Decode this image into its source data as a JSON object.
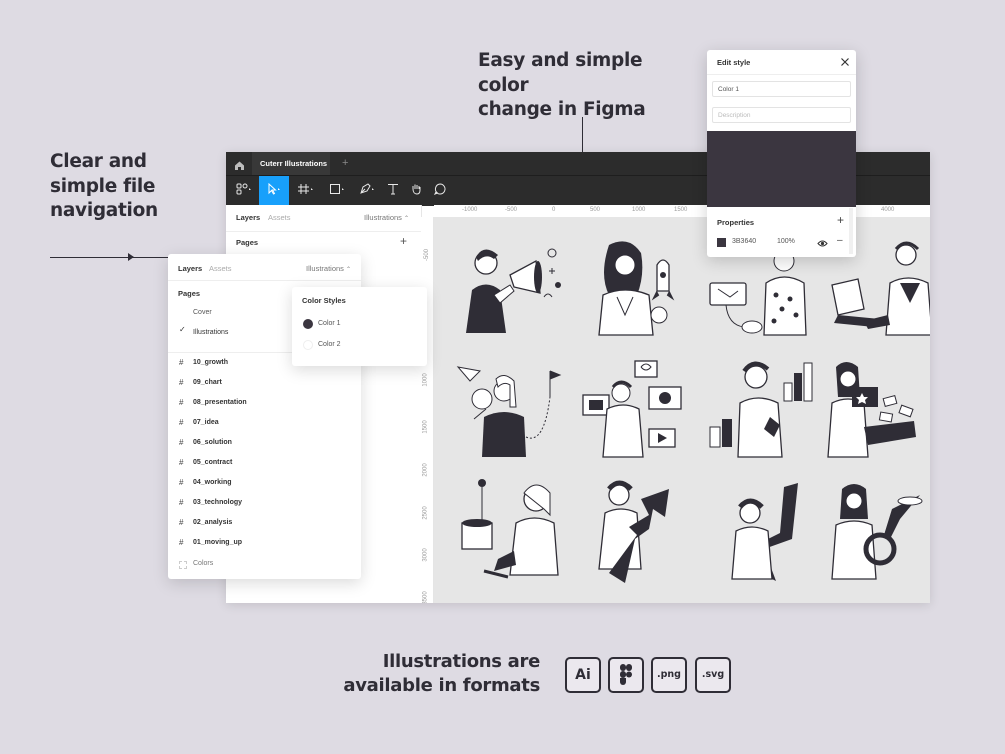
{
  "headings": {
    "left": [
      "Clear and",
      "simple file",
      "navigation"
    ],
    "top": [
      "Easy and simple color",
      "change in Figma"
    ],
    "bottom": [
      "Illustrations are",
      "available in formats"
    ]
  },
  "figma": {
    "tab_title": "Cuterr Illustrations",
    "plus": "+",
    "panel_tabs": {
      "layers": "Layers",
      "assets": "Assets",
      "page_select": "Illustrations"
    },
    "pages_label": "Pages",
    "ruler_top": [
      "-1000",
      "-500",
      "0",
      "500",
      "1000",
      "1500",
      "4000"
    ],
    "ruler_left": [
      "-500",
      "1000",
      "1500",
      "2000",
      "2500",
      "3000",
      "3500"
    ]
  },
  "layers_card": {
    "tabs": {
      "layers": "Layers",
      "assets": "Assets",
      "page_select": "Illustrations"
    },
    "pages_label": "Pages",
    "pages": [
      {
        "label": "Cover",
        "checked": false
      },
      {
        "label": "Illustrations",
        "checked": true
      }
    ],
    "frames": [
      "10_growth",
      "09_chart",
      "08_presentation",
      "07_idea",
      "06_solution",
      "05_contract",
      "04_working",
      "03_technology",
      "02_analysis",
      "01_moving_up"
    ],
    "colors_label": "Colors"
  },
  "color_styles": {
    "title": "Color Styles",
    "items": [
      {
        "label": "Color 1",
        "color": "#3B3640"
      },
      {
        "label": "Color 2",
        "color": "#FFFFFF"
      }
    ]
  },
  "edit_style": {
    "title": "Edit style",
    "name_value": "Color 1",
    "description_placeholder": "Description",
    "preview_color": "#3B3640",
    "properties_label": "Properties",
    "hex": "3B3640",
    "opacity": "100%"
  },
  "formats": [
    "Ai",
    ".png",
    ".svg"
  ],
  "colors": {
    "background": "#DEDBE3",
    "dark": "#2F2D36",
    "accent": "#18A0FB",
    "figma_dark": "#2C2C2C"
  }
}
